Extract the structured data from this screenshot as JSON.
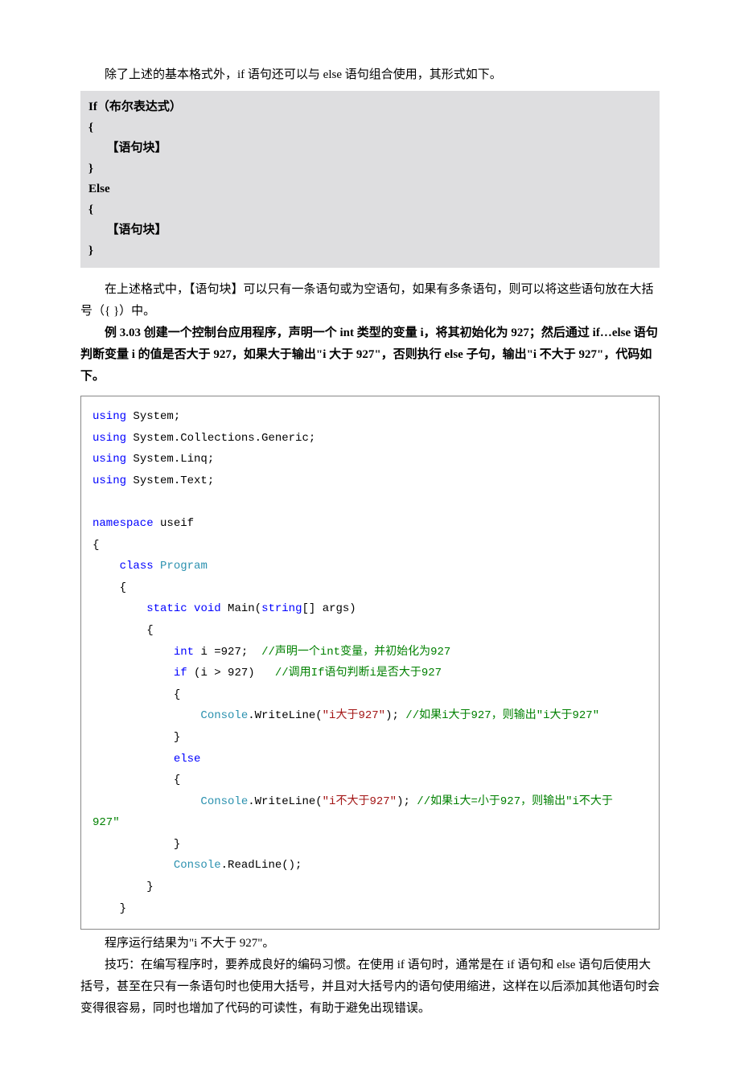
{
  "intro1": "除了上述的基本格式外，if 语句还可以与 else 语句组合使用，其形式如下。",
  "syntax": {
    "l1": "If（布尔表达式）",
    "l2": "{",
    "l3": "      【语句块】",
    "l4": "}",
    "l5": "Else",
    "l6": "{",
    "l7": "      【语句块】",
    "l8": "}"
  },
  "para2": "在上述格式中，【语句块】可以只有一条语句或为空语句，如果有多条语句，则可以将这些语句放在大括号（{ }）中。",
  "ex_prefix": "例 3.03 创建一个控制台应用程序，声明一个 int 类型的变量 i，将其初始化为 927；然后通过 if…else 语句判断变量 i 的值是否大于 927，如果大于输出\"i 大于 927\"，否则执行 else 子句，输出\"i 不大于 927\"，代码如下。",
  "code": {
    "using": "using",
    "sys": " System;",
    "sysgen": " System.Collections.Generic;",
    "syslinq": " System.Linq;",
    "systext": " System.Text;",
    "ns": "namespace",
    "nsname": " useif",
    "ob": "{",
    "cb": "}",
    "class": "class",
    "prog": "Program",
    "static": "static",
    "void": "void",
    "main": " Main(",
    "string": "string",
    "args": "[] args)",
    "int": "int",
    "ieq": " i =927;  ",
    "c1": "//声明一个int变量，并初始化为927",
    "if": "if",
    "cond": " (i > 927)   ",
    "c2": "//调用If语句判断i是否大于927",
    "console": "Console",
    "wl1a": ".WriteLine(",
    "s1": "\"i大于927\"",
    "wl1b": "); ",
    "c3": "//如果i大于927，则输出\"i大于927\"",
    "else": "else",
    "s2": "\"i不大于927\"",
    "wl2b": "); ",
    "c4a": "//如果i大=小于927，则输出\"i不大于",
    "c4b": "927\"",
    "rl": ".ReadLine();"
  },
  "result": "程序运行结果为\"i 不大于 927\"。",
  "tip": "技巧：在编写程序时，要养成良好的编码习惯。在使用 if 语句时，通常是在 if 语句和 else 语句后使用大括号，甚至在只有一条语句时也使用大括号，并且对大括号内的语句使用缩进，这样在以后添加其他语句时会变得很容易，同时也增加了代码的可读性，有助于避免出现错误。"
}
